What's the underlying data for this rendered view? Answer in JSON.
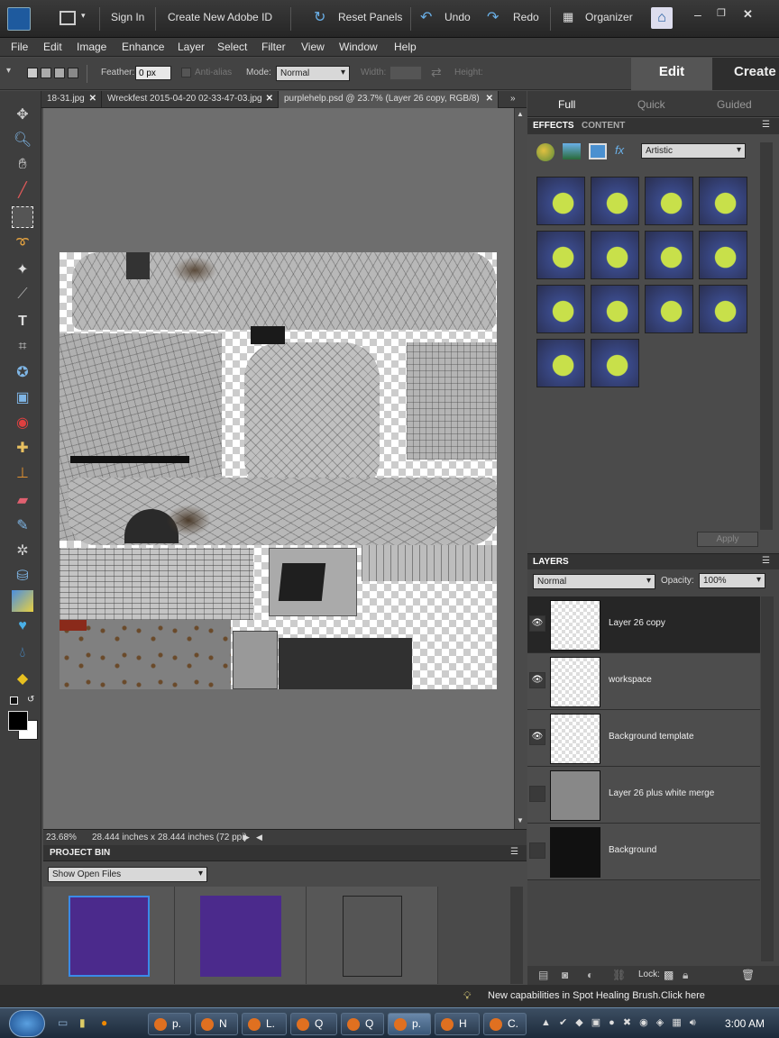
{
  "titlebar": {
    "sign_in": "Sign In",
    "create_id": "Create New Adobe ID",
    "reset_panels": "Reset Panels",
    "undo": "Undo",
    "redo": "Redo",
    "organizer": "Organizer"
  },
  "menu": [
    "File",
    "Edit",
    "Image",
    "Enhance",
    "Layer",
    "Select",
    "Filter",
    "View",
    "Window",
    "Help"
  ],
  "options": {
    "feather_label": "Feather:",
    "feather_value": "0 px",
    "antialias": "Anti-alias",
    "mode_label": "Mode:",
    "mode_value": "Normal",
    "width_label": "Width:",
    "height_label": "Height:"
  },
  "modes": {
    "edit": "Edit",
    "create": "Create"
  },
  "doc_tabs": [
    "18-31.jpg",
    "Wreckfest 2015-04-20 02-33-47-03.jpg",
    "purplehelp.psd @ 23.7% (Layer 26 copy, RGB/8)"
  ],
  "status": {
    "zoom": "23.68%",
    "size": "28.444 inches x 28.444 inches (72 ppi)"
  },
  "project_bin": {
    "title": "PROJECT BIN",
    "show": "Show Open Files"
  },
  "edit_modes": {
    "full": "Full",
    "quick": "Quick",
    "guided": "Guided"
  },
  "effects": {
    "tab1": "EFFECTS",
    "tab2": "CONTENT",
    "category": "Artistic",
    "apply": "Apply"
  },
  "layers_panel": {
    "title": "LAYERS",
    "blend": "Normal",
    "opacity_label": "Opacity:",
    "opacity_value": "100%",
    "lock_label": "Lock:",
    "layers": [
      {
        "name": "Layer 26 copy",
        "visible": true,
        "selected": true
      },
      {
        "name": "workspace",
        "visible": true,
        "selected": false
      },
      {
        "name": "Background template",
        "visible": true,
        "selected": false
      },
      {
        "name": "Layer 26 plus white merge",
        "visible": false,
        "selected": false
      },
      {
        "name": "Background",
        "visible": false,
        "selected": false
      }
    ]
  },
  "tip": "New capabilities in Spot Healing Brush.Click here",
  "taskbar": {
    "items": [
      "p.",
      "N",
      "L.",
      "Q",
      "Q",
      "p.",
      "H",
      "C."
    ],
    "clock": "3:00 AM"
  },
  "colors": {
    "accent": "#7fb6e6",
    "selected_layer": "#262626",
    "thumb_purple": "#4b2a8c"
  }
}
